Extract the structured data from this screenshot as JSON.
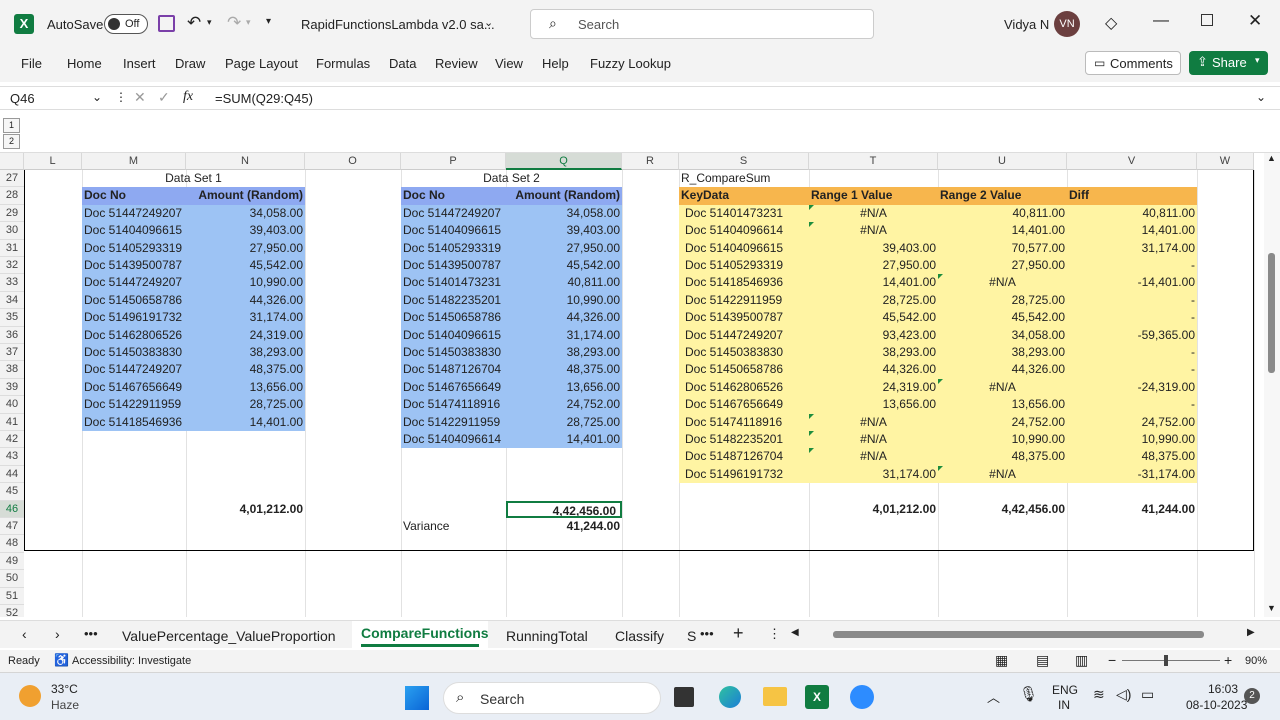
{
  "title": {
    "autosave": "AutoSave",
    "toggle": "Off",
    "filename": "RapidFunctionsLambda v2.0 sa...",
    "search": "Search",
    "user": "Vidya N",
    "initials": "VN"
  },
  "menu": [
    "File",
    "Home",
    "Insert",
    "Draw",
    "Page Layout",
    "Formulas",
    "Data",
    "Review",
    "View",
    "Help",
    "Fuzzy Lookup"
  ],
  "ribbon": {
    "comments": "Comments",
    "share": "Share"
  },
  "formula": {
    "namebox": "Q46",
    "fx": "fx",
    "value": "=SUM(Q29:Q45)"
  },
  "columns": [
    "L",
    "M",
    "N",
    "O",
    "P",
    "Q",
    "R",
    "S",
    "T",
    "U",
    "V",
    "W"
  ],
  "rows": [
    "27",
    "28",
    "29",
    "30",
    "31",
    "32",
    "33",
    "34",
    "35",
    "36",
    "37",
    "38",
    "39",
    "40",
    "41",
    "42",
    "43",
    "44",
    "45",
    "46",
    "47",
    "48",
    "49",
    "50",
    "51",
    "52"
  ],
  "set1": {
    "title": "Data Set 1",
    "h1": "Doc No",
    "h2": "Amount (Random)",
    "rows": [
      [
        "Doc 51447249207",
        "34,058.00"
      ],
      [
        "Doc 51404096615",
        "39,403.00"
      ],
      [
        "Doc 51405293319",
        "27,950.00"
      ],
      [
        "Doc 51439500787",
        "45,542.00"
      ],
      [
        "Doc 51447249207",
        "10,990.00"
      ],
      [
        "Doc 51450658786",
        "44,326.00"
      ],
      [
        "Doc 51496191732",
        "31,174.00"
      ],
      [
        "Doc 51462806526",
        "24,319.00"
      ],
      [
        "Doc 51450383830",
        "38,293.00"
      ],
      [
        "Doc 51447249207",
        "48,375.00"
      ],
      [
        "Doc 51467656649",
        "13,656.00"
      ],
      [
        "Doc 51422911959",
        "28,725.00"
      ],
      [
        "Doc 51418546936",
        "14,401.00"
      ]
    ],
    "total": "4,01,212.00"
  },
  "set2": {
    "title": "Data Set 2",
    "h1": "Doc No",
    "h2": "Amount (Random)",
    "rows": [
      [
        "Doc 51447249207",
        "34,058.00"
      ],
      [
        "Doc 51404096615",
        "39,403.00"
      ],
      [
        "Doc 51405293319",
        "27,950.00"
      ],
      [
        "Doc 51439500787",
        "45,542.00"
      ],
      [
        "Doc 51401473231",
        "40,811.00"
      ],
      [
        "Doc 51482235201",
        "10,990.00"
      ],
      [
        "Doc 51450658786",
        "44,326.00"
      ],
      [
        "Doc 51404096615",
        "31,174.00"
      ],
      [
        "Doc 51450383830",
        "38,293.00"
      ],
      [
        "Doc 51487126704",
        "48,375.00"
      ],
      [
        "Doc 51467656649",
        "13,656.00"
      ],
      [
        "Doc 51474118916",
        "24,752.00"
      ],
      [
        "Doc 51422911959",
        "28,725.00"
      ],
      [
        "Doc 51404096614",
        "14,401.00"
      ]
    ],
    "total": "4,42,456.00",
    "variance_label": "Variance",
    "variance": "41,244.00"
  },
  "compare": {
    "title": "R_CompareSum",
    "h1": "KeyData",
    "h2": "Range 1 Value",
    "h3": "Range 2 Value",
    "h4": "Diff",
    "rows": [
      [
        "Doc 51401473231",
        "#N/A",
        "40,811.00",
        "40,811.00"
      ],
      [
        "Doc 51404096614",
        "#N/A",
        "14,401.00",
        "14,401.00"
      ],
      [
        "Doc 51404096615",
        "39,403.00",
        "70,577.00",
        "31,174.00"
      ],
      [
        "Doc 51405293319",
        "27,950.00",
        "27,950.00",
        "-"
      ],
      [
        "Doc 51418546936",
        "14,401.00",
        "#N/A",
        "-14,401.00"
      ],
      [
        "Doc 51422911959",
        "28,725.00",
        "28,725.00",
        "-"
      ],
      [
        "Doc 51439500787",
        "45,542.00",
        "45,542.00",
        "-"
      ],
      [
        "Doc 51447249207",
        "93,423.00",
        "34,058.00",
        "-59,365.00"
      ],
      [
        "Doc 51450383830",
        "38,293.00",
        "38,293.00",
        "-"
      ],
      [
        "Doc 51450658786",
        "44,326.00",
        "44,326.00",
        "-"
      ],
      [
        "Doc 51462806526",
        "24,319.00",
        "#N/A",
        "-24,319.00"
      ],
      [
        "Doc 51467656649",
        "13,656.00",
        "13,656.00",
        "-"
      ],
      [
        "Doc 51474118916",
        "#N/A",
        "24,752.00",
        "24,752.00"
      ],
      [
        "Doc 51482235201",
        "#N/A",
        "10,990.00",
        "10,990.00"
      ],
      [
        "Doc 51487126704",
        "#N/A",
        "48,375.00",
        "48,375.00"
      ],
      [
        "Doc 51496191732",
        "31,174.00",
        "#N/A",
        "-31,174.00"
      ]
    ],
    "t1": "4,01,212.00",
    "t2": "4,42,456.00",
    "t3": "41,244.00"
  },
  "sheets": [
    "ValuePercentage_ValueProportion",
    "CompareFunctions",
    "RunningTotal",
    "Classify",
    "S"
  ],
  "status": {
    "ready": "Ready",
    "access": "Accessibility: Investigate",
    "zoom": "90%"
  },
  "taskbar": {
    "temp": "33°C",
    "weather": "Haze",
    "search": "Search",
    "lang1": "ENG",
    "lang2": "IN",
    "time": "16:03",
    "date": "08-10-2023",
    "notif": "2"
  },
  "colors": {
    "blue_fill": "#9dc3f4",
    "blue_header": "#8ea9f1",
    "yellow_fill": "#fff4a3",
    "yellow_header": "#f7b64d",
    "excel_green": "#107c41"
  }
}
